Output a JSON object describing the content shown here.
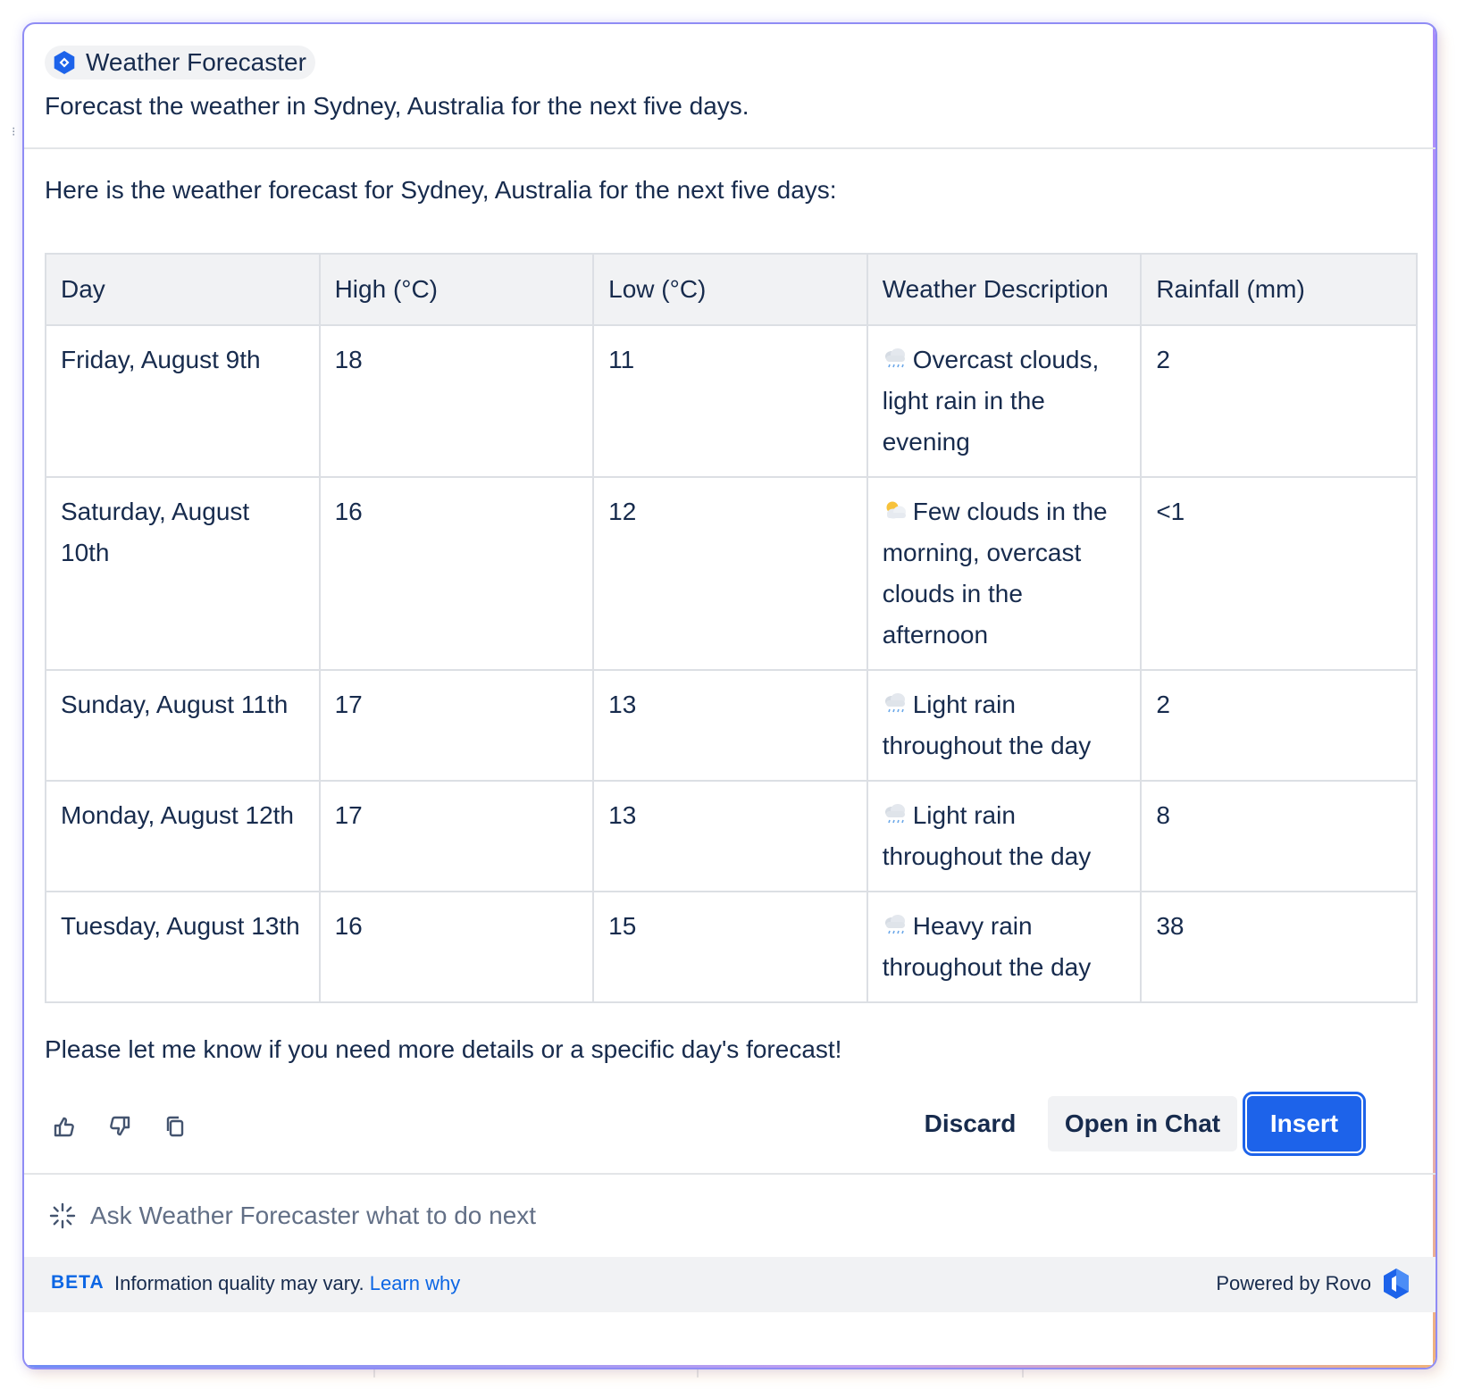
{
  "agent": {
    "name": "Weather Forecaster",
    "icon": "agent-hexagon-icon",
    "accent_color": "#1d63ea"
  },
  "prompt": "Forecast the weather in Sydney, Australia for the next five days.",
  "response": {
    "intro": "Here is the weather forecast for Sydney, Australia for the next five days:",
    "table": {
      "headers": [
        "Day",
        "High (°C)",
        "Low (°C)",
        "Weather Description",
        "Rainfall (mm)"
      ],
      "rows": [
        {
          "day": "Friday, August 9th",
          "high": "18",
          "low": "11",
          "icon": "rain-cloud-icon",
          "description": "Overcast clouds, light rain in the evening",
          "rainfall": "2"
        },
        {
          "day": "Saturday, August 10th",
          "high": "16",
          "low": "12",
          "icon": "sun-behind-cloud-icon",
          "description": "Few clouds in the morning, overcast clouds in the afternoon",
          "rainfall": "<1"
        },
        {
          "day": "Sunday, August 11th",
          "high": "17",
          "low": "13",
          "icon": "rain-cloud-icon",
          "description": "Light rain throughout the day",
          "rainfall": "2"
        },
        {
          "day": "Monday, August 12th",
          "high": "17",
          "low": "13",
          "icon": "rain-cloud-icon",
          "description": "Light rain throughout the day",
          "rainfall": "8"
        },
        {
          "day": "Tuesday, August 13th",
          "high": "16",
          "low": "15",
          "icon": "rain-cloud-icon",
          "description": "Heavy rain throughout the day",
          "rainfall": "38"
        }
      ]
    },
    "closing": "Please let me know if you need more details or a specific day's forecast!"
  },
  "actions": {
    "thumbs_up_icon": "thumbs-up-icon",
    "thumbs_down_icon": "thumbs-down-icon",
    "copy_icon": "copy-icon",
    "discard_label": "Discard",
    "open_in_chat_label": "Open in Chat",
    "insert_label": "Insert"
  },
  "ask": {
    "icon": "sparkle-loader-icon",
    "placeholder": "Ask Weather Forecaster what to do next"
  },
  "footer": {
    "beta_label": "BETA",
    "note": "Information quality may vary.",
    "learn_link": "Learn why",
    "powered_by": "Powered by Rovo",
    "logo": "rovo-logo-icon"
  }
}
